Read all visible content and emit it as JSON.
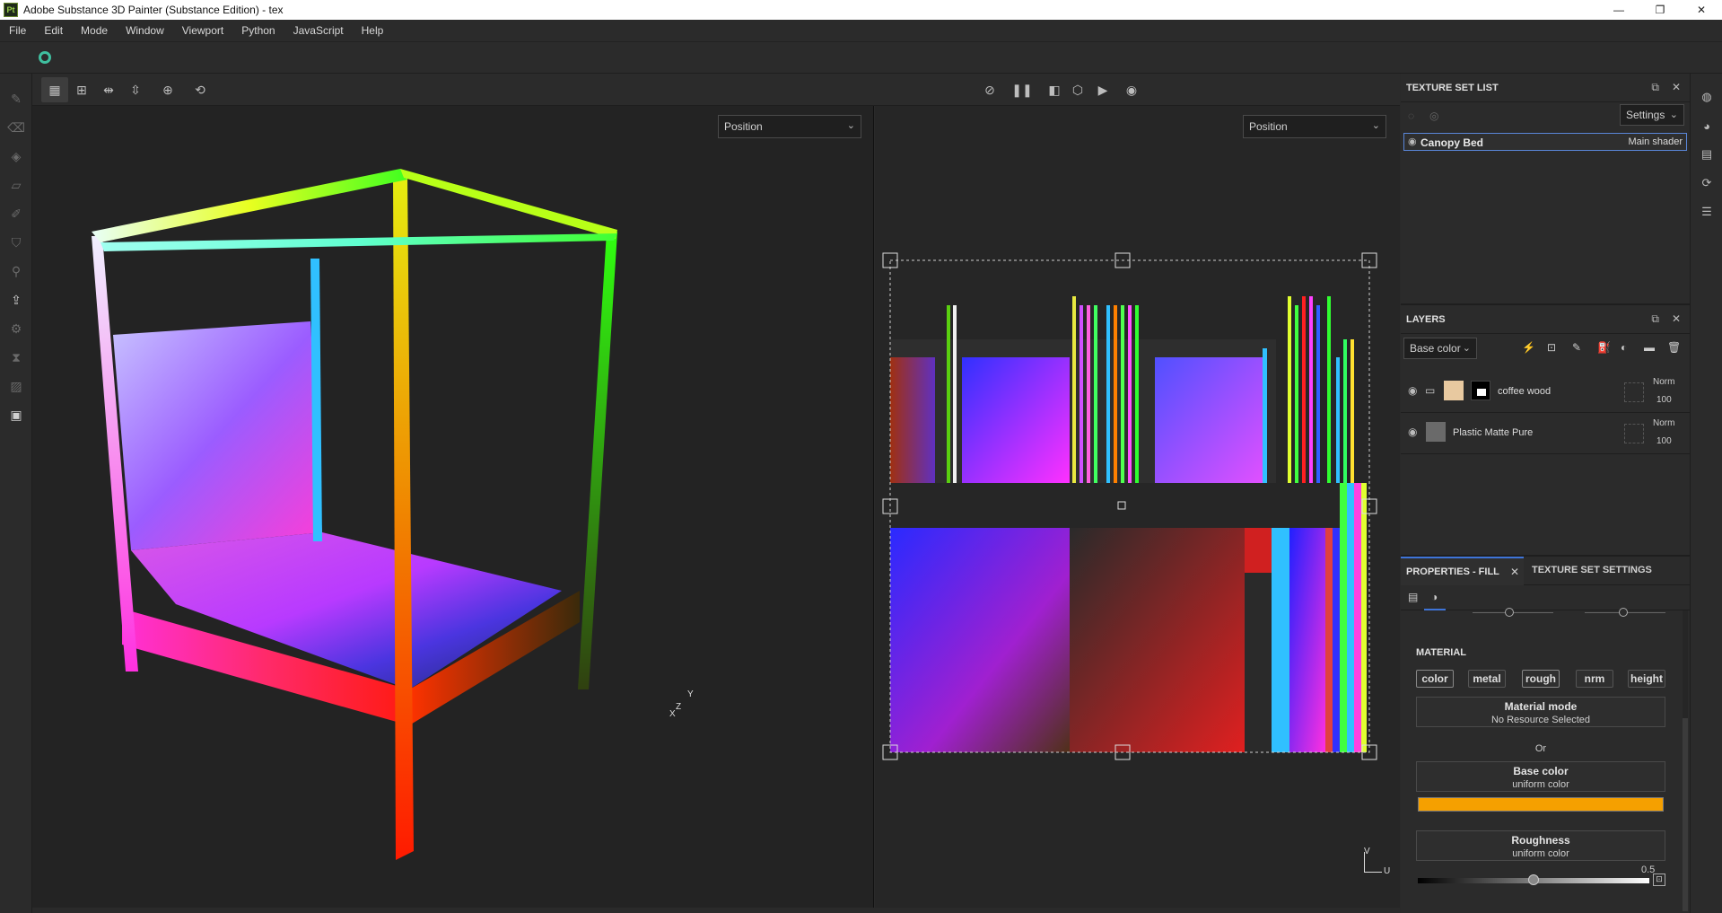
{
  "app": {
    "icon_text": "Pt",
    "title": "Adobe Substance 3D Painter (Substance Edition) - tex"
  },
  "window_controls": {
    "minimize": "—",
    "restore": "❐",
    "close": "✕"
  },
  "menu": [
    "File",
    "Edit",
    "Mode",
    "Window",
    "Viewport",
    "Python",
    "JavaScript",
    "Help"
  ],
  "viewport": {
    "left_mode": "Position",
    "right_mode": "Position",
    "gizmo_3d": {
      "y": "Y",
      "z": "Z",
      "x": "X"
    },
    "gizmo_2d": {
      "v": "V",
      "u": "U"
    }
  },
  "texture_set_list": {
    "title": "TEXTURE SET LIST",
    "settings_label": "Settings",
    "item_name": "Canopy Bed",
    "item_shader": "Main shader"
  },
  "layers": {
    "title": "LAYERS",
    "channel": "Base color",
    "items": [
      {
        "name": "coffee wood",
        "blend": "Norm",
        "opacity": "100"
      },
      {
        "name": "Plastic Matte Pure",
        "blend": "Norm",
        "opacity": "100"
      }
    ]
  },
  "properties": {
    "tab_active": "PROPERTIES - FILL",
    "tab_other": "TEXTURE SET SETTINGS",
    "material_heading": "MATERIAL",
    "channels": [
      "color",
      "metal",
      "rough",
      "nrm",
      "height"
    ],
    "material_mode_title": "Material mode",
    "material_mode_value": "No Resource Selected",
    "or_label": "Or",
    "base_color_title": "Base color",
    "base_color_sub": "uniform color",
    "base_color_hex": "#f5a000",
    "roughness_title": "Roughness",
    "roughness_sub": "uniform color",
    "roughness_value": "0.5"
  }
}
